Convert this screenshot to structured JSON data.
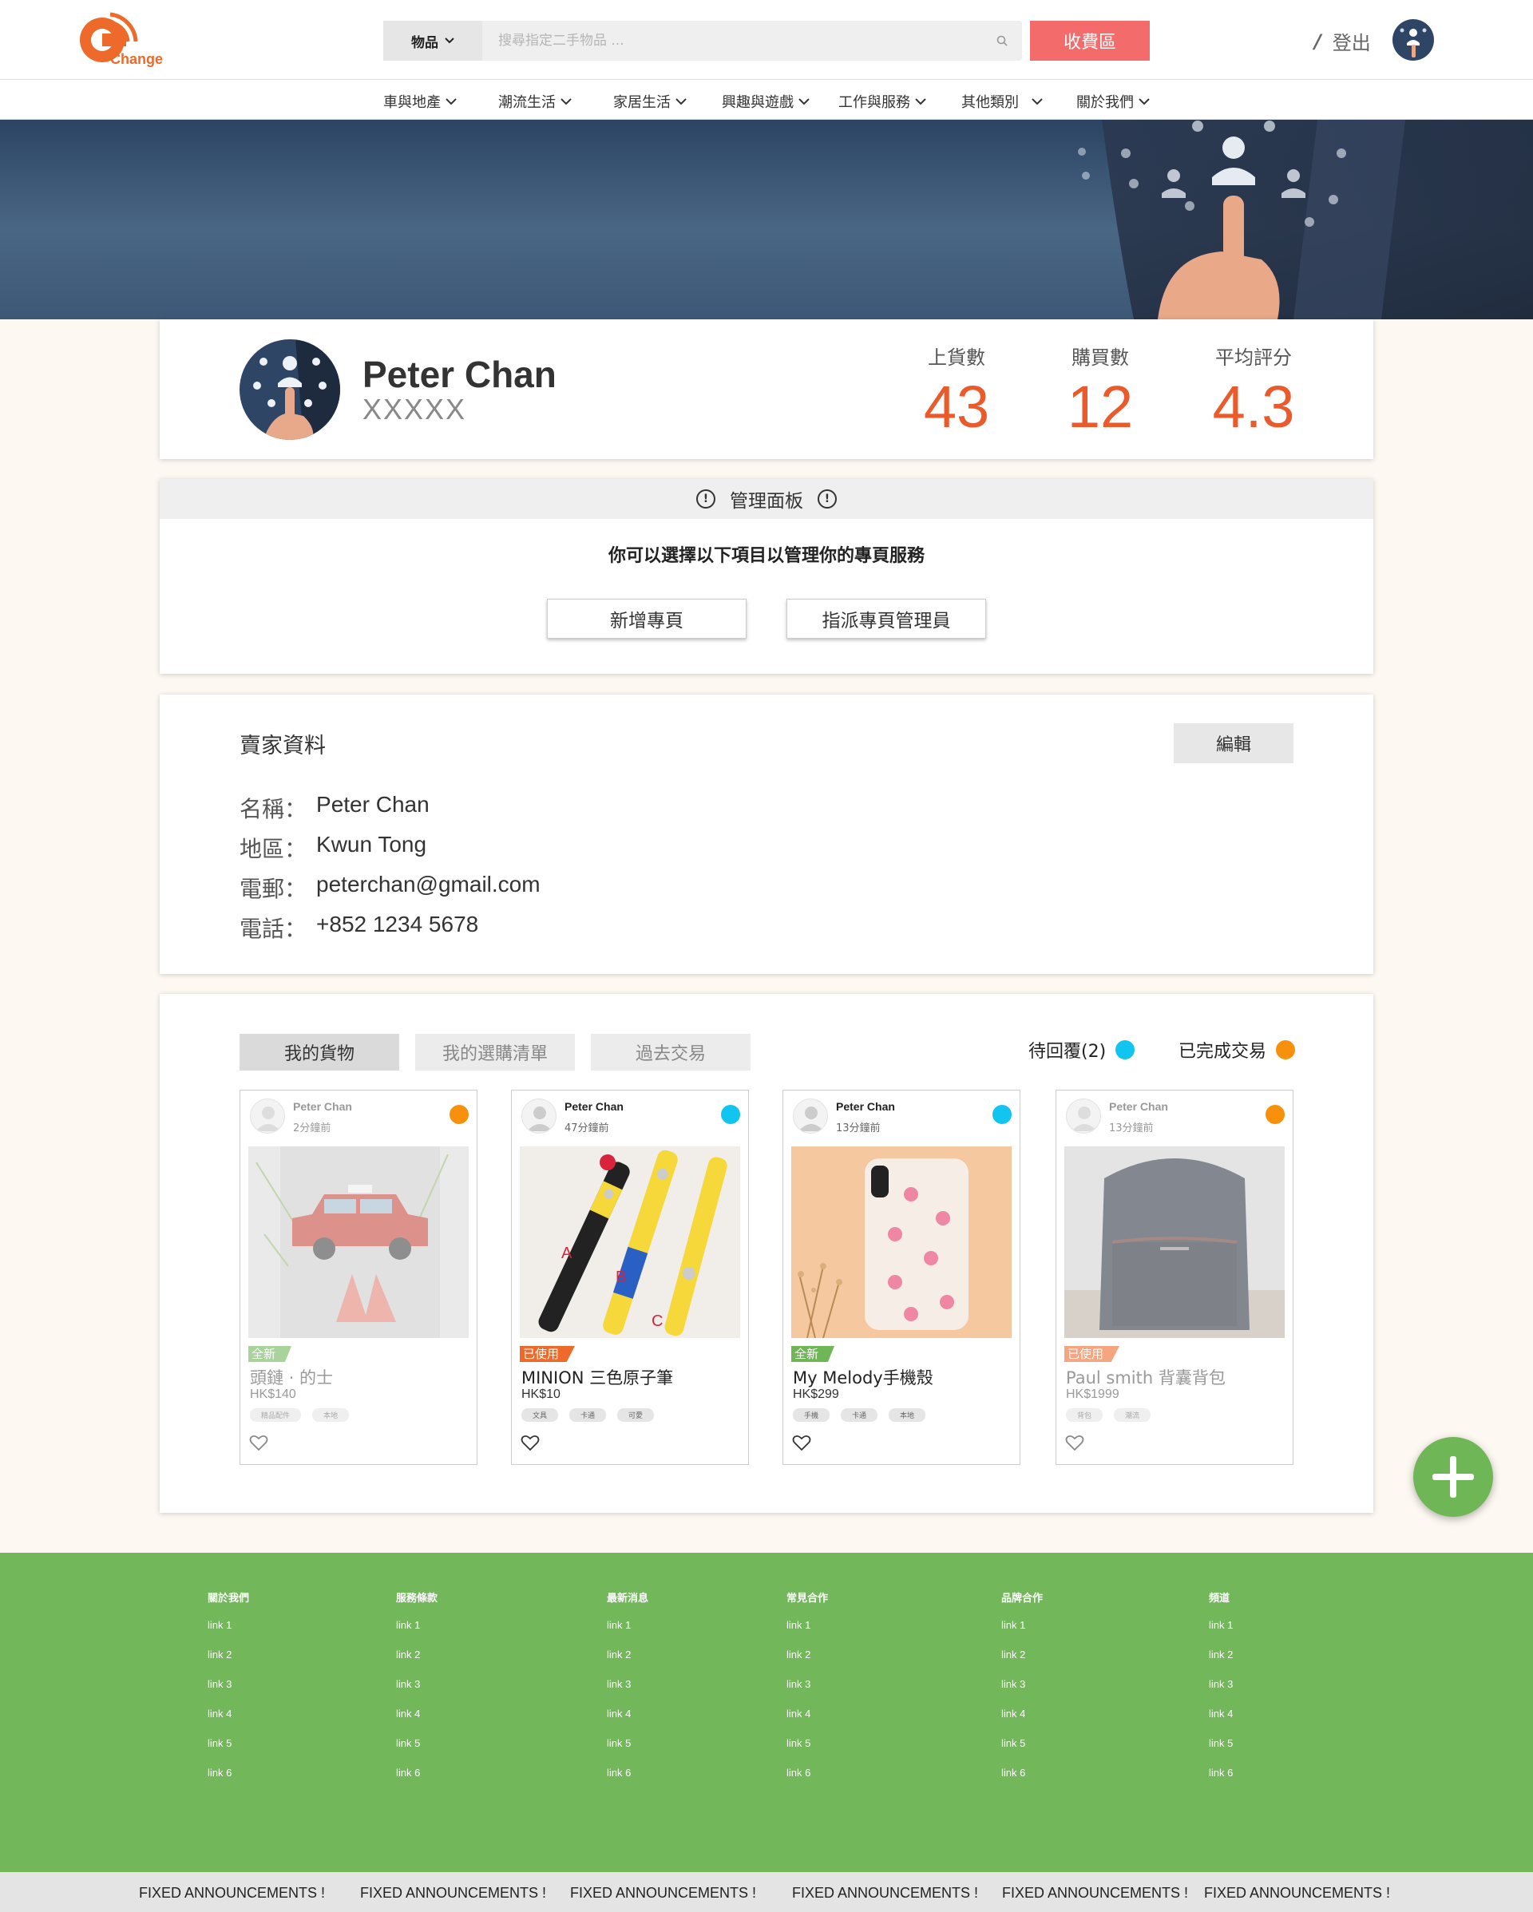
{
  "header": {
    "logo_text": "Change",
    "search_category": "物品",
    "search_placeholder": "搜尋指定二手物品 ...",
    "pay_button": "收費區",
    "logout": "登出",
    "slash": "/"
  },
  "nav": [
    "車與地產",
    "潮流生活",
    "家居生活",
    "興趣與遊戲",
    "工作與服務",
    "其他類別",
    "關於我們"
  ],
  "profile": {
    "name": "Peter Chan",
    "subtitle": "XXXXX",
    "stats": [
      {
        "label": "上貨數",
        "value": "43"
      },
      {
        "label": "購買數",
        "value": "12"
      },
      {
        "label": "平均評分",
        "value": "4.3"
      }
    ]
  },
  "management": {
    "title": "管理面板",
    "description": "你可以選擇以下項目以管理你的專頁服務",
    "buttons": [
      "新增專頁",
      "指派專頁管理員"
    ]
  },
  "seller": {
    "title": "賣家資料",
    "edit": "編輯",
    "fields": [
      {
        "key": "名稱：",
        "value": "Peter Chan"
      },
      {
        "key": "地區：",
        "value": "Kwun Tong"
      },
      {
        "key": "電郵：",
        "value": "peterchan@gmail.com"
      },
      {
        "key": "電話：",
        "value": "+852 1234 5678"
      }
    ]
  },
  "goods": {
    "tabs": [
      "我的貨物",
      "我的選購清單",
      "過去交易"
    ],
    "legend": [
      {
        "label": "待回覆(2)",
        "color": "#12c4f0"
      },
      {
        "label": "已完成交易",
        "color": "#f7900a"
      }
    ],
    "items": [
      {
        "user": "Peter Chan",
        "time": "2分鐘前",
        "status_color": "#f7900a",
        "tag": "全新",
        "tag_color": "#6fb657",
        "title": "頭鏈 · 的士",
        "price": "HK$140",
        "chips": [
          "精品配件",
          "本地"
        ],
        "faded": true
      },
      {
        "user": "Peter Chan",
        "time": "47分鐘前",
        "status_color": "#12c4f0",
        "tag": "已使用",
        "tag_color": "#ee6a2b",
        "title": "MINION 三色原子筆",
        "price": "HK$10",
        "chips": [
          "文具",
          "卡通",
          "可愛"
        ],
        "faded": false
      },
      {
        "user": "Peter Chan",
        "time": "13分鐘前",
        "status_color": "#12c4f0",
        "tag": "全新",
        "tag_color": "#6fb657",
        "title": "My Melody手機殼",
        "price": "HK$299",
        "chips": [
          "手機",
          "卡通",
          "本地"
        ],
        "faded": false
      },
      {
        "user": "Peter Chan",
        "time": "13分鐘前",
        "status_color": "#f7900a",
        "tag": "已使用",
        "tag_color": "#ee6a2b",
        "title": "Paul smith 背囊背包",
        "price": "HK$1999",
        "chips": [
          "背包",
          "潮流"
        ],
        "faded": true
      }
    ]
  },
  "footer": {
    "columns": [
      {
        "title": "關於我們",
        "links": [
          "link 1",
          "link 2",
          "link 3",
          "link 4",
          "link 5",
          "link 6"
        ]
      },
      {
        "title": "服務條款",
        "links": [
          "link 1",
          "link 2",
          "link 3",
          "link 4",
          "link 5",
          "link 6"
        ]
      },
      {
        "title": "最新消息",
        "links": [
          "link 1",
          "link 2",
          "link 3",
          "link 4",
          "link 5",
          "link 6"
        ]
      },
      {
        "title": "常見合作",
        "links": [
          "link 1",
          "link 2",
          "link 3",
          "link 4",
          "link 5",
          "link 6"
        ]
      },
      {
        "title": "品牌合作",
        "links": [
          "link 1",
          "link 2",
          "link 3",
          "link 4",
          "link 5",
          "link 6"
        ]
      },
      {
        "title": "頻道",
        "links": [
          "link 1",
          "link 2",
          "link 3",
          "link 4",
          "link 5",
          "link 6"
        ]
      }
    ],
    "announcements": [
      "FIXED ANNOUNCEMENTS !",
      "FIXED ANNOUNCEMENTS !",
      "FIXED ANNOUNCEMENTS !",
      "FIXED ANNOUNCEMENTS !",
      "FIXED ANNOUNCEMENTS !",
      "FIXED ANNOUNCEMENTS !"
    ]
  },
  "colors": {
    "accent": "#ea5a2a",
    "pay": "#f36b6b",
    "footer": "#72b75a",
    "pending": "#12c4f0",
    "done": "#f7900a"
  }
}
